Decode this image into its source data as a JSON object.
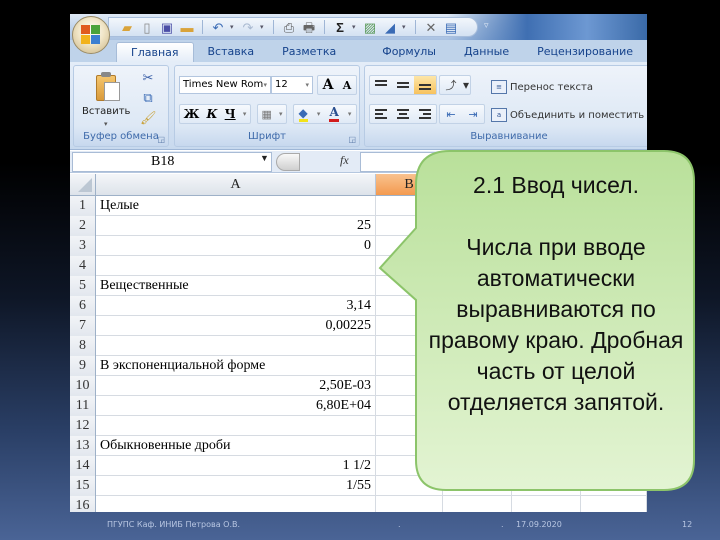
{
  "quick_access": {
    "icons": [
      "office-button",
      "open-folder-icon",
      "new-document-icon",
      "save-icon",
      "folder-icon",
      "undo-icon",
      "redo-icon",
      "print-preview-icon",
      "print-icon",
      "autosum-icon",
      "chart-icon",
      "text-direction-icon",
      "close-icon",
      "form-icon",
      "customize-toolbar-icon"
    ]
  },
  "tabs": [
    "Главная",
    "Вставка",
    "Разметка страницы",
    "Формулы",
    "Данные",
    "Рецензирование"
  ],
  "active_tab": "Главная",
  "ribbon": {
    "clipboard": {
      "label": "Буфер обмена",
      "paste_label": "Вставить"
    },
    "font": {
      "label": "Шрифт",
      "font_name": "Times New Rom",
      "font_size": "12",
      "bold": "Ж",
      "italic": "К",
      "underline": "Ч",
      "grow": "A",
      "shrink": "A"
    },
    "alignment": {
      "label": "Выравнивание",
      "wrap_text": "Перенос текста",
      "merge_center": "Объединить и поместить в"
    }
  },
  "formula_bar": {
    "name_box": "B18",
    "fx": "fx",
    "formula": ""
  },
  "sheet": {
    "columns": [
      "A",
      "B"
    ],
    "selected_column": "B",
    "rows": [
      {
        "n": "1",
        "a": "Целые",
        "type": "text"
      },
      {
        "n": "2",
        "a": "25",
        "type": "num"
      },
      {
        "n": "3",
        "a": "0",
        "type": "num"
      },
      {
        "n": "4",
        "a": "",
        "type": "text"
      },
      {
        "n": "5",
        "a": "Вещественные",
        "type": "text"
      },
      {
        "n": "6",
        "a": "3,14",
        "type": "num"
      },
      {
        "n": "7",
        "a": "0,00225",
        "type": "num"
      },
      {
        "n": "8",
        "a": "",
        "type": "text"
      },
      {
        "n": "9",
        "a": "В экспоненциальной форме",
        "type": "text"
      },
      {
        "n": "10",
        "a": "2,50E-03",
        "type": "num"
      },
      {
        "n": "11",
        "a": "6,80E+04",
        "type": "num"
      },
      {
        "n": "12",
        "a": "",
        "type": "text"
      },
      {
        "n": "13",
        "a": "Обыкновенные дроби",
        "type": "text"
      },
      {
        "n": "14",
        "a": "1 1/2",
        "type": "num"
      },
      {
        "n": "15",
        "a": "1/55",
        "type": "num"
      },
      {
        "n": "16",
        "a": "",
        "type": "text"
      }
    ]
  },
  "callout": {
    "title": "2.1 Ввод чисел.",
    "body": "Числа при вводе автоматически выравниваются по правому краю. Дробная часть от целой отделяется запятой.",
    "fill": "#c8e8a8",
    "border": "#8cc46a"
  },
  "footer": {
    "org": "ПГУПС  Каф. ИНИБ   Петрова О.В.",
    "dot1": ".",
    "dot2": ".",
    "date": "17.09.2020",
    "page": "12"
  }
}
